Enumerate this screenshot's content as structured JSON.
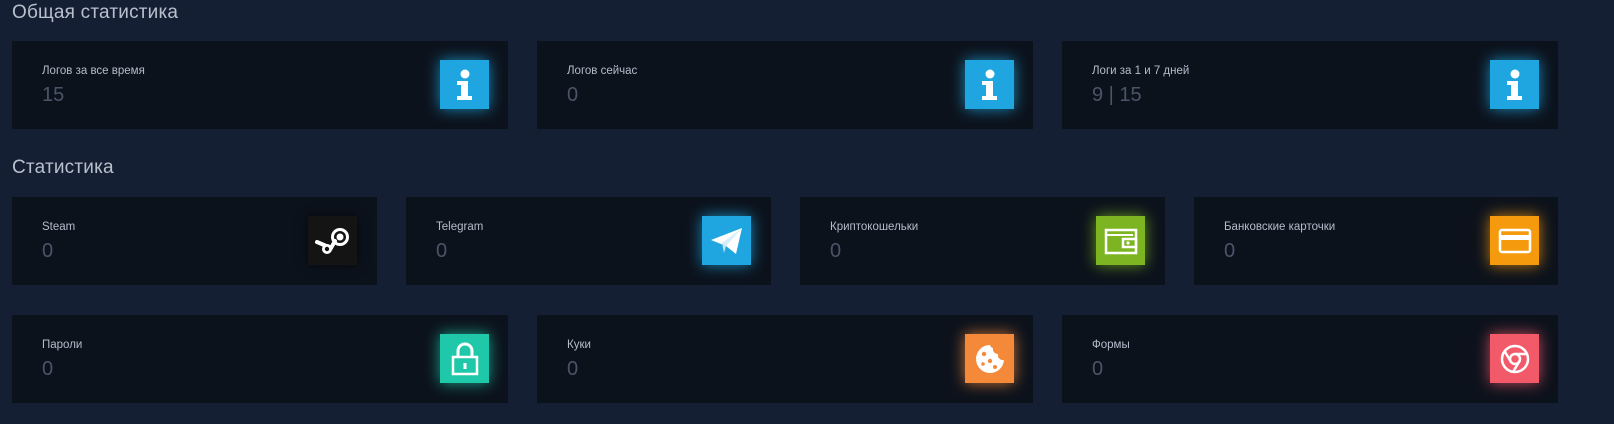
{
  "sections": {
    "general_title": "Общая статистика",
    "stats_title": "Статистика"
  },
  "general": [
    {
      "label": "Логов за все время",
      "value": "15",
      "icon": "info-icon",
      "color": "#1fa6e0"
    },
    {
      "label": "Логов сейчас",
      "value": "0",
      "icon": "info-icon",
      "color": "#1fa6e0"
    },
    {
      "label": "Логи за 1 и 7 дней",
      "value": "9 | 15",
      "icon": "info-icon",
      "color": "#1fa6e0"
    }
  ],
  "stats": [
    {
      "label": "Steam",
      "value": "0",
      "icon": "steam-icon",
      "color": "#1b1b1b"
    },
    {
      "label": "Telegram",
      "value": "0",
      "icon": "telegram-icon",
      "color": "#1fa6e0"
    },
    {
      "label": "Криптокошельки",
      "value": "0",
      "icon": "wallet-icon",
      "color": "#7cb521"
    },
    {
      "label": "Банковские карточки",
      "value": "0",
      "icon": "credit-card-icon",
      "color": "#f59a0c"
    },
    {
      "label": "Пароли",
      "value": "0",
      "icon": "lock-icon",
      "color": "#1fc8a8"
    },
    {
      "label": "Куки",
      "value": "0",
      "icon": "cookie-icon",
      "color": "#f5893a"
    },
    {
      "label": "Формы",
      "value": "0",
      "icon": "chrome-icon",
      "color": "#f25a6a"
    }
  ]
}
